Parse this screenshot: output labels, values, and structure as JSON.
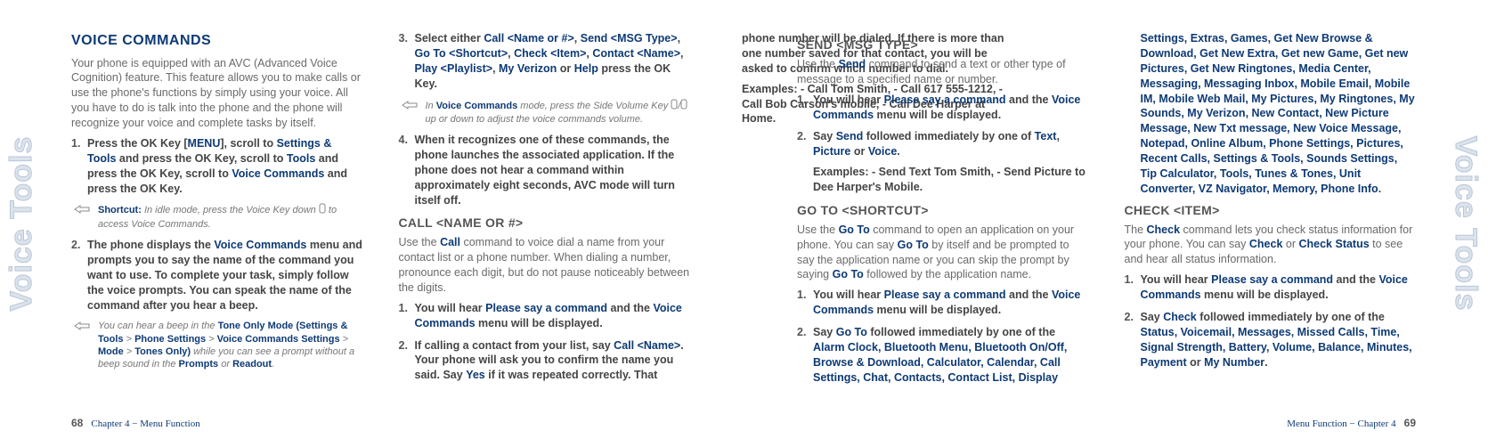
{
  "left": {
    "title": "VOICE COMMANDS",
    "intro": "Your phone is equipped with an AVC (Advanced Voice Cognition) feature. This feature allows you to make calls or use the phone's functions by simply using your voice. All you have to do is talk into the phone and the phone will recognize your voice and complete tasks by itself.",
    "step1a": "Press the OK Key [",
    "step1b": "], scroll to ",
    "step1c": " and press the OK Key, scroll to ",
    "step1d": " and press the OK Key, scroll to ",
    "step1e": " and press the OK Key.",
    "menu": "MENU",
    "settingsTools": "Settings & Tools",
    "tools": "Tools",
    "voiceCommands": "Voice Commands",
    "tip1a": "Shortcut:",
    "tip1b": " In idle mode, press the Voice Key down ",
    "tip1c": " to access Voice Commands.",
    "step2a": "The phone displays the ",
    "step2b": " menu and prompts you to say the name of the command you want to use. To complete your task, simply follow the voice prompts. You can speak the name of the command after you hear a beep.",
    "tip2a": "You can hear a beep in the ",
    "tip2b": "Tone Only Mode (Settings & Tools",
    "tip2c": " > ",
    "tip2d": "Phone Settings",
    "tip2e": "Voice Commands Settings",
    "tip2f": "Mode",
    "tip2g": "Tones Only)",
    "tip2h": " while you can see a prompt without a beep sound in the ",
    "tip2i": "Prompts",
    "tip2j": " or ",
    "tip2k": "Readout",
    "tip2l": ".",
    "step3a": "Select either ",
    "c1": "Call <Name or #>",
    "c2": "Send <MSG Type>",
    "c3": "Go To <Shortcut>",
    "c4": "Check <Item>",
    "c5": "Contact <Name>",
    "c6": "Play <Playlist>",
    "c7": "My Verizon",
    "cor": " or ",
    "c8": "Help",
    "step3b": " press the OK Key.",
    "tip3a": "In ",
    "tip3b": "Voice Commands",
    "tip3c": " mode, press the Side Volume Key ",
    "tip3d": " up or down to adjust the voice commands volume.",
    "step4": "When it recognizes one of these commands, the phone launches the associated application. If the phone does not hear a command within approximately eight seconds, AVC mode will turn itself off.",
    "callTitle": "CALL <NAME OR #>",
    "callIntro1": "Use the ",
    "callIntroCmd": "Call",
    "callIntro2": " command to voice dial a name from your contact list or a phone number. When dialing a number, pronounce each digit, but do not pause noticeably between the digits.",
    "hear1a": "You will hear ",
    "pleaseSay": "Please say a command",
    "hear1b": " and the ",
    "hear1c": " menu will be displayed.",
    "call2a": "If calling a contact from your list, say ",
    "callName": "Call <Name>",
    "call2b": ". Your phone will ask you to confirm the name you said. Say ",
    "yes": "Yes",
    "call2c": " if it was repeated correctly. That phone number will be dialed. If there is more than one number saved for that contact, you will be asked to confirm which number to dial.",
    "examplesLabel": "Examples:",
    "callEx": " - Call Tom Smith, - Call 617 555-1212, - Call Bob Carson's mobile, - Call Dee Harper at Home.",
    "footerPage": "68",
    "footerChapter": "Chapter 4 − Menu Function"
  },
  "right": {
    "sendTitle": "SEND <MSG TYPE>",
    "sendIntro1": "Use the ",
    "sendCmd": "Send",
    "sendIntro2": " command to send a text or other type of message to a specified name or number.",
    "send2a": "Say ",
    "send2b": " followed immediately by one of ",
    "t1": "Text",
    "t2": "Picture",
    "t3": "Voice",
    "sendEx": " - Send Text Tom Smith, - Send Picture to Dee Harper's Mobile.",
    "gotoTitle": "GO TO <SHORTCUT>",
    "gotoIntro1": "Use the ",
    "gotoCmd": "Go To",
    "gotoIntro2": " command to open an application on your phone. You can say ",
    "gotoIntro3": " by itself and be prompted to say the application name or you can skip the prompt by saying ",
    "gotoIntro4": " followed by the application name.",
    "goto2a": "Say ",
    "goto2b": " followed immediately by one of the ",
    "apps": "Alarm Clock, Bluetooth Menu, Bluetooth On/Off, Browse & Download, Calculator, Calendar, Call Settings, Chat, Contacts, Contact List, Display Settings, Extras, Games, Get New Browse & Download, Get New Extra, Get new Game, Get new Pictures, Get New Ringtones, Media Center, Messaging, Messaging Inbox, Mobile Email, Mobile IM, Mobile Web Mail, My Pictures, My Ringtones, My Sounds, My Verizon, New Contact, New Picture Message, New Txt message, New Voice Message, Notepad, Online Album, Phone Settings, Pictures, Recent Calls, Settings & Tools, Sounds Settings, Tip Calculator, Tools, Tunes & Tones, Unit Converter, VZ Navigator, Memory, Phone Info",
    "checkTitle": "CHECK <ITEM>",
    "checkIntro1": "The ",
    "checkCmd": "Check",
    "checkIntro2": " command lets you check status information for your phone. You can say ",
    "checkIntro3": " or ",
    "checkStatus": "Check Status",
    "checkIntro4": " to see and hear all status information.",
    "check2a": "Say ",
    "check2b": " followed immediately by one of the ",
    "items": "Status, Voicemail, Messages, Missed Calls, Time, Signal Strength, Battery, Volume, Balance, Minutes, Payment",
    "check2c": " or ",
    "myNumber": "My Number",
    "footerChapter": "Menu Function − Chapter 4",
    "footerPage": "69"
  },
  "tab": "Voice Tools"
}
